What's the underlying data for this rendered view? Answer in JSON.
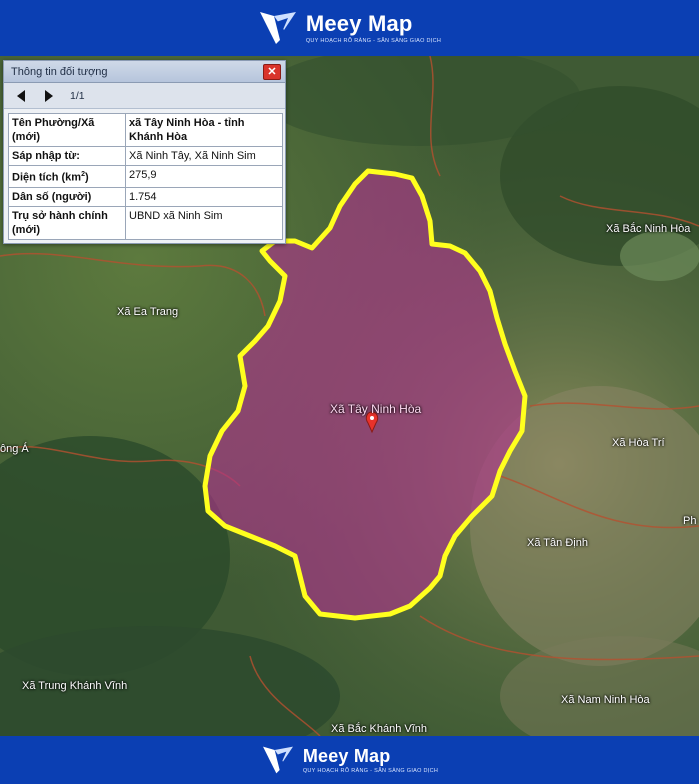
{
  "header": {
    "brand_name": "Meey Map",
    "tagline": "QUY HOẠCH RÕ RÀNG - SẴN SÀNG GIAO DỊCH"
  },
  "footer": {
    "brand_name": "Meey Map",
    "tagline": "QUY HOẠCH RÕ RÀNG - SẴN SÀNG GIAO DỊCH"
  },
  "panel": {
    "title": "Thông tin đối tượng",
    "close_label": "✕",
    "pager": "1/1",
    "rows": [
      {
        "key": "Tên Phường/Xã (mới)",
        "value": "xã Tây Ninh Hòa - tỉnh Khánh Hòa"
      },
      {
        "key": "Sáp nhập từ:",
        "value": "Xã Ninh Tây, Xã Ninh Sim"
      },
      {
        "key": "Diện tích (km",
        "key_sup": "2",
        "key_tail": ")",
        "value": "275,9"
      },
      {
        "key": "Dân số (người)",
        "value": "1.754"
      },
      {
        "key": "Trụ sở hành chính (mới)",
        "value": "UBND xã Ninh Sim"
      }
    ]
  },
  "map": {
    "labels": {
      "center": "Xã Tây Ninh Hòa",
      "ea_trang": "Xã Ea Trang",
      "bac_ninh_hoa": "Xã Bắc Ninh Hòa",
      "hoa_tri": "Xã Hòa Trí",
      "tan_dinh": "Xã Tân Định",
      "trung_khanh_vinh": "Xã Trung Khánh Vĩnh",
      "bac_khanh_vinh": "Xã Bắc Khánh Vĩnh",
      "nam_ninh_hoa": "Xã Nam Ninh Hòa",
      "left_edge": "ông Á",
      "right_edge": "Ph"
    },
    "colors": {
      "boundary": "#ffff1e",
      "fill": "#b0328e",
      "marker": "#e8322b"
    }
  }
}
